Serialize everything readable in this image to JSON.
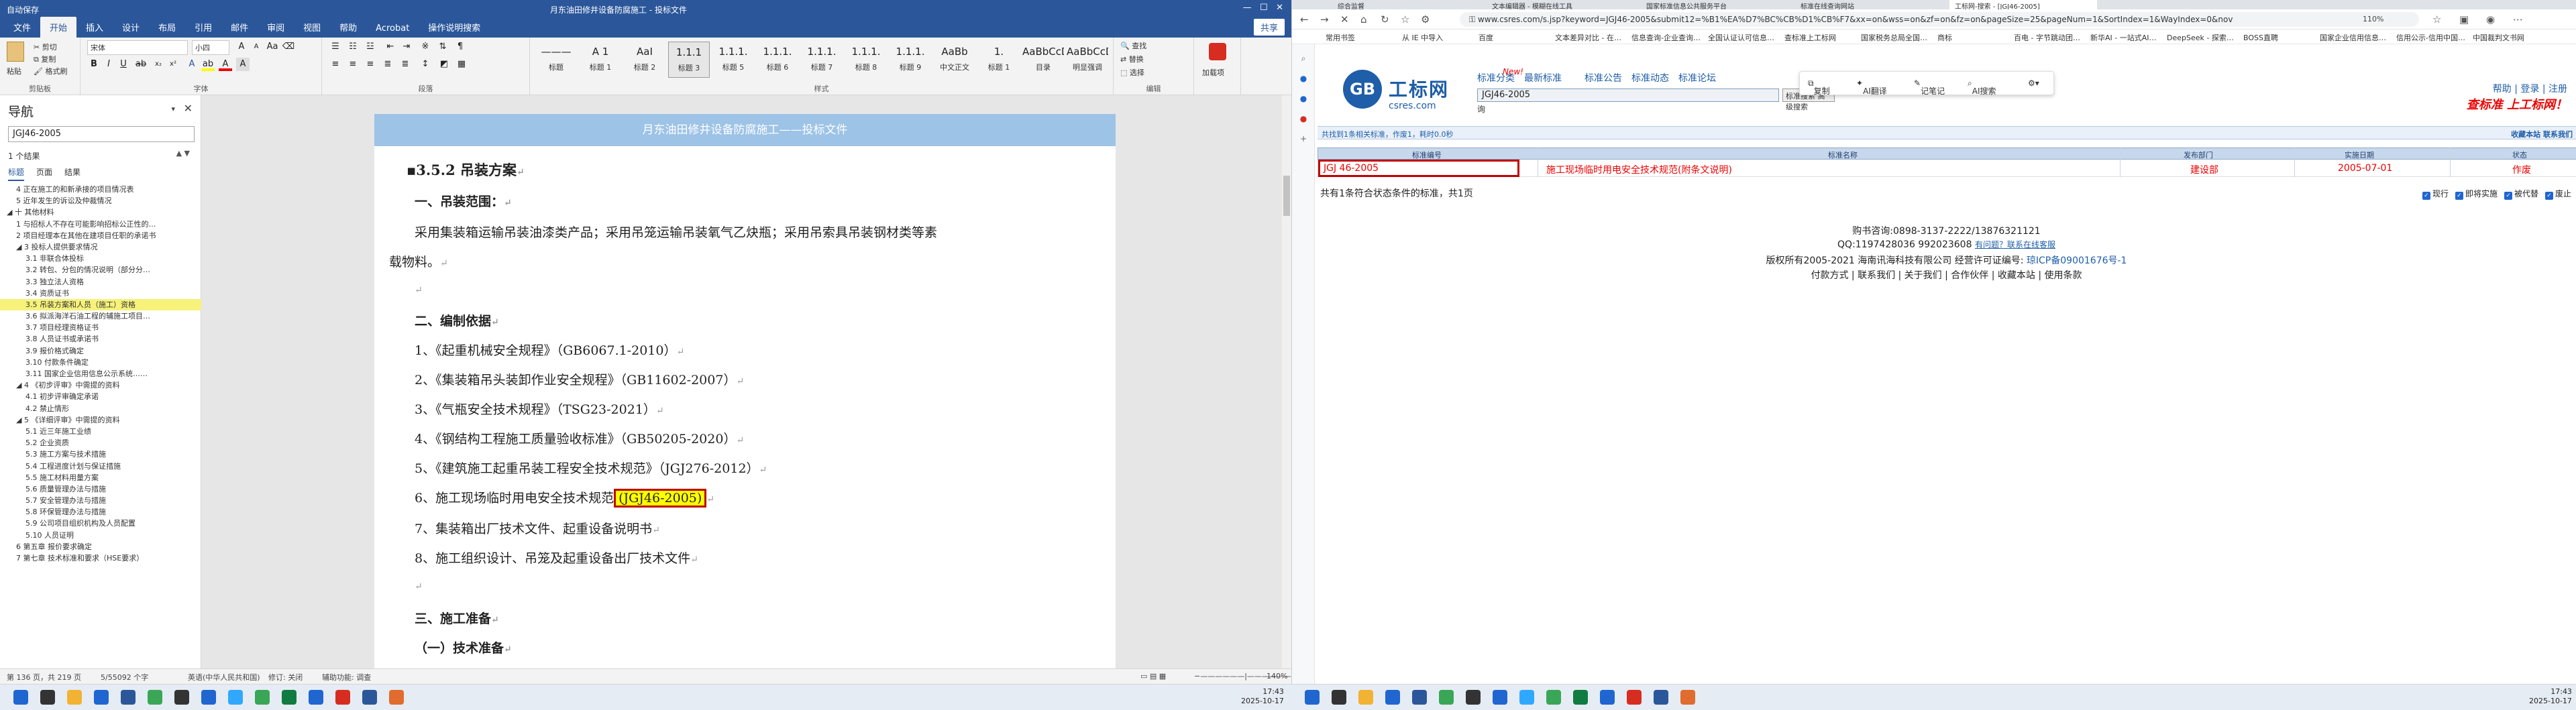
{
  "word": {
    "title_left": "自动保存",
    "title_center": "月东油田修井设备防腐施工 - 投标文件",
    "share": "共享",
    "tabs": [
      "文件",
      "开始",
      "插入",
      "设计",
      "布局",
      "引用",
      "邮件",
      "审阅",
      "视图",
      "帮助",
      "Acrobat",
      "操作说明搜索"
    ],
    "ribbon": {
      "paste": "粘贴",
      "cut": "剪切",
      "copy": "复制",
      "format_painter": "格式刷",
      "clipboard": "剪贴板",
      "font_name": "宋体",
      "font_size": "小四",
      "font": "字体",
      "paragraph": "段落",
      "styles": "样式",
      "editing": "编辑",
      "find": "查找",
      "replace": "替换",
      "select": "选择",
      "adobe": "加载项",
      "style_items": [
        {
          "preview": "———",
          "name": "标题"
        },
        {
          "preview": "A 1",
          "name": "标题 1"
        },
        {
          "preview": "AaI",
          "name": "标题 2"
        },
        {
          "preview": "1.1.1",
          "name": "标题 3"
        },
        {
          "preview": "1.1.1.",
          "name": "标题 5"
        },
        {
          "preview": "1.1.1.",
          "name": "标题 6"
        },
        {
          "preview": "1.1.1.",
          "name": "标题 7"
        },
        {
          "preview": "1.1.1.",
          "name": "标题 8"
        },
        {
          "preview": "1.1.1.",
          "name": "标题 9"
        },
        {
          "preview": "AaBb",
          "name": "中文正文"
        },
        {
          "preview": "1.",
          "name": "标题 1"
        },
        {
          "preview": "AaBbCcD",
          "name": "目录"
        },
        {
          "preview": "AaBbCcD",
          "name": "明显强调"
        }
      ]
    },
    "nav": {
      "title": "导航",
      "search_value": "JGJ46-2005",
      "count": "1 个结果",
      "tabs": [
        "标题",
        "页面",
        "结果"
      ],
      "items": [
        {
          "text": "4 正在施工的和新承接的项目情况表",
          "indent": 1,
          "hl": false
        },
        {
          "text": "5 近年发生的诉讼及仲裁情况",
          "indent": 1,
          "hl": false
        },
        {
          "text": "◢ 十 其他材料",
          "indent": 0,
          "hl": false
        },
        {
          "text": "1 与招标人不存在可能影响招标公正性的…",
          "indent": 1,
          "hl": false
        },
        {
          "text": "2 项目经理本在其他在建项目任职的承诺书",
          "indent": 1,
          "hl": false
        },
        {
          "text": "◢ 3 投标人提供要求情况",
          "indent": 1,
          "hl": false
        },
        {
          "text": "3.1 非联合体投标",
          "indent": 2,
          "hl": false
        },
        {
          "text": "3.2 转包、分包的情况说明（部分分…",
          "indent": 2,
          "hl": false
        },
        {
          "text": "3.3 独立法人资格",
          "indent": 2,
          "hl": false
        },
        {
          "text": "3.4 资质证书",
          "indent": 2,
          "hl": false
        },
        {
          "text": "3.5 吊装方案和人员（施工）资格",
          "indent": 2,
          "hl": true
        },
        {
          "text": "3.6 拟派海洋石油工程的辅施工项目…",
          "indent": 2,
          "hl": false
        },
        {
          "text": "3.7 项目经理资格证书",
          "indent": 2,
          "hl": false
        },
        {
          "text": "3.8 人员证书或承诺书",
          "indent": 2,
          "hl": false
        },
        {
          "text": "3.9 报价格式确定",
          "indent": 2,
          "hl": false
        },
        {
          "text": "3.10 付款条件确定",
          "indent": 2,
          "hl": false
        },
        {
          "text": "3.11 国家企业信用信息公示系统……",
          "indent": 2,
          "hl": false
        },
        {
          "text": "◢ 4 《初步评审》中需提的资料",
          "indent": 1,
          "hl": false
        },
        {
          "text": "4.1 初步评审确定承诺",
          "indent": 2,
          "hl": false
        },
        {
          "text": "4.2 禁止情形",
          "indent": 2,
          "hl": false
        },
        {
          "text": "◢ 5 《详细评审》中需提的资料",
          "indent": 1,
          "hl": false
        },
        {
          "text": "5.1 近三年施工业绩",
          "indent": 2,
          "hl": false
        },
        {
          "text": "5.2 企业资质",
          "indent": 2,
          "hl": false
        },
        {
          "text": "5.3 施工方案与技术措施",
          "indent": 2,
          "hl": false
        },
        {
          "text": "5.4 工程进度计划与保证措施",
          "indent": 2,
          "hl": false
        },
        {
          "text": "5.5 施工材料用量方案",
          "indent": 2,
          "hl": false
        },
        {
          "text": "5.6 质量管理办法与措施",
          "indent": 2,
          "hl": false
        },
        {
          "text": "5.7 安全管理办法与措施",
          "indent": 2,
          "hl": false
        },
        {
          "text": "5.8 环保管理办法与措施",
          "indent": 2,
          "hl": false
        },
        {
          "text": "5.9 公司项目组织机构及人员配置",
          "indent": 2,
          "hl": false
        },
        {
          "text": "5.10 人员证明",
          "indent": 2,
          "hl": false
        },
        {
          "text": "6 第五章 报价要求确定",
          "indent": 1,
          "hl": false
        },
        {
          "text": "7 第七章 技术标准和要求（HSE要求）",
          "indent": 1,
          "hl": false
        }
      ]
    },
    "doc": {
      "header": "月东油田修井设备防腐施工——投标文件",
      "heading": "3.5.2 吊装方案",
      "s1": "一、吊装范围：",
      "p1a": "采用集装箱运输吊装油漆类产品；采用吊笼运输吊装氧气乙炔瓶；采用吊索具吊装钢材类等素",
      "p1b": "载物料。",
      "s2": "二、编制依据",
      "basis": [
        "1、《起重机械安全规程》（GB6067.1-2010）",
        "2、《集装箱吊头装卸作业安全规程》（GB11602-2007）",
        "3、《气瓶安全技术规程》（TSG23-2021）",
        "4、《钢结构工程施工质量验收标准》（GB50205-2020）",
        "5、《建筑施工起重吊装工程安全技术规范》（JGJ276-2012）"
      ],
      "item6_pre": "6、施工现场临时用电安全技术规范",
      "item6_hl": "(JGJ46-2005)",
      "item7": "7、集装箱出厂技术文件、起重设备说明书",
      "item8": "8、施工组织设计、吊笼及起重设备出厂技术文件",
      "s3": "三、施工准备",
      "s3_1": "（一）技术准备"
    },
    "status": {
      "page": "第 136 页，共 219 页",
      "words": "5/55092 个字",
      "lang": "英语(中华人民共和国)",
      "track": "修订: 关闭",
      "access": "辅助功能: 调查",
      "zoom": "140%"
    }
  },
  "browser": {
    "tabs": [
      "综合监督",
      "文本编辑器 - 模糊在线工具",
      "国家标准信息公共服务平台",
      "标准在线查询网站",
      "工标网-搜索 - [JGJ46-2005]"
    ],
    "url": "www.csres.com/s.jsp?keyword=JGJ46-2005&submit12=%B1%EA%D7%BC%CB%D1%CB%F7&xx=on&wss=on&zf=on&fz=on&pageSize=25&pageNum=1&SortIndex=1&WayIndex=0&nov",
    "zoom": "110%",
    "bookmarks": [
      "常用书签",
      "从 IE 中导入",
      "百度",
      "文本差异对比 - 在…",
      "信息查询-企业查询…",
      "全国认证认可信息…",
      "查标准上工标网",
      "国家税务总局全国…",
      "商标",
      "百电 - 字节跳动团…",
      "新华AI - 一站式AI…",
      "DeepSeek - 探索…",
      "BOSS直聘",
      "国家企业信用信息…",
      "信用公示-信用中国…",
      "中国裁判文书网"
    ],
    "site": {
      "logo_mark": "GB",
      "logo_cn": "工标网",
      "logo_en": "csres.com",
      "nav": [
        "标准分类",
        "最新标准",
        "标准公告",
        "标准动态",
        "标准论坛"
      ],
      "new_badge": "New!",
      "search_value": "JGJ46-2005",
      "search_btn": "标准搜索 高级搜索",
      "sub": "询",
      "popup": [
        "复制",
        "AI翻译",
        "记笔记",
        "AI搜索"
      ],
      "right_links": "帮助 | 登录 | 注册",
      "slogan": "查标准 上工标网！",
      "result_info": "共找到1条相关标准，作废1，耗时0.0秒",
      "result_right": "收藏本站  联系我们",
      "columns": [
        "标准编号",
        "标准名称",
        "发布部门",
        "实施日期",
        "状态"
      ],
      "row": {
        "code": "JGJ 46-2005",
        "name": "施工现场临时用电安全技术规范(附条文说明)",
        "dept": "建设部",
        "date": "2005-07-01",
        "status": "作废"
      },
      "summary": "共有1条符合状态条件的标准，共1页",
      "filters": [
        "现行",
        "即将实施",
        "被代替",
        "废止"
      ],
      "footer": {
        "phone": "购书咨询:0898-3137-2222/13876321121",
        "qq_pre": "QQ:1197428036 992023608 ",
        "qq_link": "有问题？联系在线客服",
        "copyright": "版权所有2005-2021 海南讯海科技有限公司 经营许可证编号: ",
        "icp": "琼ICP备09001676号-1",
        "links": "付款方式 | 联系我们 | 关于我们 | 合作伙伴 | 收藏本站 | 使用条款"
      }
    }
  },
  "taskbar": {
    "time1": "17:43",
    "date1": "2025-10-17",
    "time2": "17:43",
    "date2": "2025-10-17"
  }
}
